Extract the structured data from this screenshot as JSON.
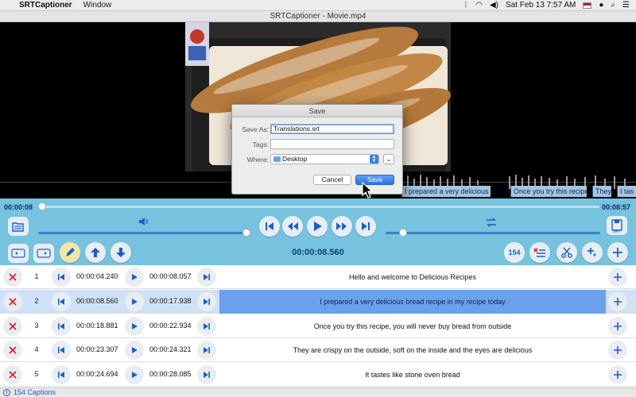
{
  "menubar": {
    "app_name": "SRTCaptioner",
    "menus": [
      "Window"
    ],
    "clock": "Sat Feb 13  7:57 AM"
  },
  "window": {
    "title": "SRTCaptioner - Movie.mp4"
  },
  "caption_strip": [
    {
      "text": "I prepared a very delicious bread recipe in my recipe toda"
    },
    {
      "text": "Once you try this recipe"
    },
    {
      "text": "They"
    },
    {
      "text": "I tas"
    }
  ],
  "dialog": {
    "title": "Save",
    "save_as_label": "Save As:",
    "save_as_value": "Translations.srt",
    "tags_label": "Tags:",
    "tags_value": "",
    "where_label": "Where:",
    "where_value": "Desktop",
    "cancel_label": "Cancel",
    "save_label": "Save"
  },
  "player": {
    "elapsed": "00:00:08",
    "duration": "00:08:57",
    "current_time": "00:00:08.560",
    "progress_fraction": 0.007,
    "volume_fraction": 1.0,
    "speed_fraction": 0.08,
    "caption_count_badge": "154",
    "srt_label": "SRT"
  },
  "captions": [
    {
      "num": "1",
      "start": "00:00:04.240",
      "end": "00:00:08.057",
      "text": "Hello and welcome to Delicious Recipes",
      "selected": false
    },
    {
      "num": "2",
      "start": "00:00:08.560",
      "end": "00:00:17.938",
      "text": "I prepared a very delicious bread recipe in my recipe today",
      "selected": true
    },
    {
      "num": "3",
      "start": "00:00:18.881",
      "end": "00:00:22.934",
      "text": "Once you try this recipe, you will never buy bread from outside",
      "selected": false
    },
    {
      "num": "4",
      "start": "00:00:23.307",
      "end": "00:00:24.321",
      "text": "They are crispy on the outside, soft on the inside and the eyes are delicious",
      "selected": false
    },
    {
      "num": "5",
      "start": "00:00:24.694",
      "end": "00:00:28.085",
      "text": "It tastes like stone oven bread",
      "selected": false
    }
  ],
  "status": {
    "text": "154 Captions"
  },
  "colors": {
    "accent": "#2a73e0",
    "toolbar": "#76c2df",
    "selected_row": "#6aa1ec",
    "delete_red": "#e0202a"
  }
}
